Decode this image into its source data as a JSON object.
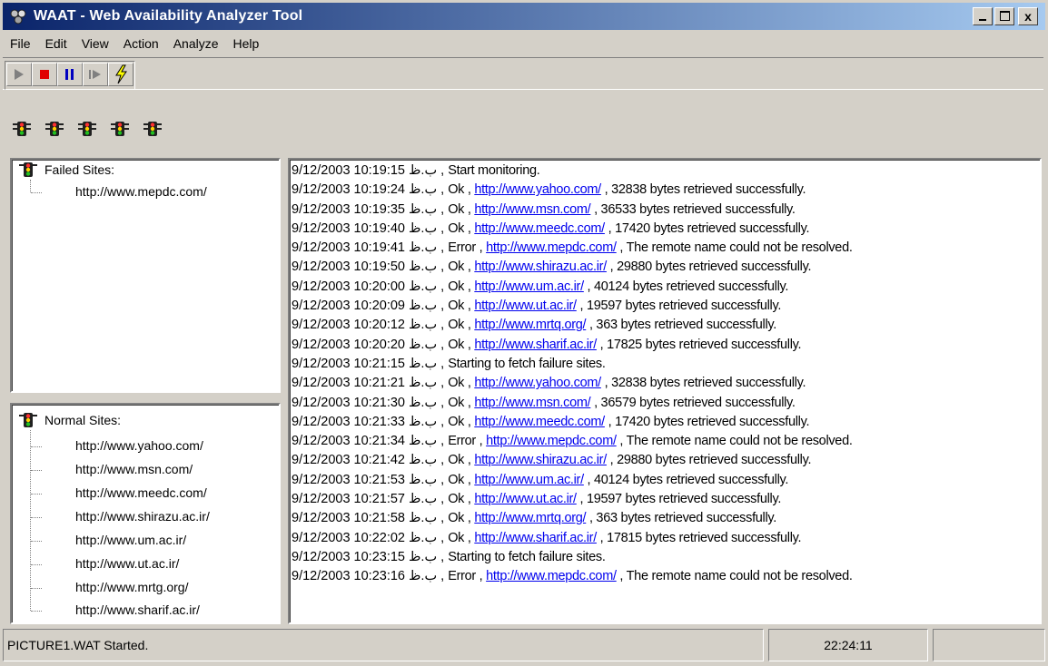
{
  "window": {
    "title": "WAAT - Web Availability Analyzer Tool",
    "title_bar_color": "#0a246a",
    "controls": [
      "minimize-icon",
      "maximize-icon",
      "close-icon"
    ],
    "close_label": "x"
  },
  "menu": [
    "File",
    "Edit",
    "View",
    "Action",
    "Analyze",
    "Help"
  ],
  "toolbar": {
    "buttons": [
      {
        "name": "play",
        "icon": "play-icon",
        "enabled": false
      },
      {
        "name": "stop",
        "icon": "stop-icon",
        "enabled": true,
        "color": "#e00000"
      },
      {
        "name": "pause",
        "icon": "pause-icon",
        "enabled": true,
        "color": "#0000c0"
      },
      {
        "name": "step",
        "icon": "step-icon",
        "enabled": false
      },
      {
        "name": "analyze",
        "icon": "lightning-icon",
        "enabled": true,
        "color": "#ffff00"
      }
    ]
  },
  "status_lights": [
    "traffic-light-icon",
    "traffic-light-icon",
    "traffic-light-icon",
    "traffic-light-icon",
    "traffic-light-icon"
  ],
  "failed_sites": {
    "label": "Failed Sites:",
    "items": [
      "http://www.mepdc.com/"
    ]
  },
  "normal_sites": {
    "label": "Normal Sites:",
    "items": [
      "http://www.yahoo.com/",
      "http://www.msn.com/",
      "http://www.meedc.com/",
      "http://www.shirazu.ac.ir/",
      "http://www.um.ac.ir/",
      "http://www.ut.ac.ir/",
      "http://www.mrtg.org/",
      "http://www.sharif.ac.ir/"
    ]
  },
  "log": [
    {
      "ts": "9/12/2003 10:19:15 ب.ظ",
      "pre": " , Start monitoring.",
      "url": "",
      "post": ""
    },
    {
      "ts": "9/12/2003 10:19:24 ب.ظ",
      "pre": " , Ok , ",
      "url": "http://www.yahoo.com/",
      "post": " , 32838 bytes retrieved successfully."
    },
    {
      "ts": "9/12/2003 10:19:35 ب.ظ",
      "pre": " , Ok , ",
      "url": "http://www.msn.com/",
      "post": " , 36533 bytes retrieved successfully."
    },
    {
      "ts": "9/12/2003 10:19:40 ب.ظ",
      "pre": " , Ok , ",
      "url": "http://www.meedc.com/",
      "post": " , 17420 bytes retrieved successfully."
    },
    {
      "ts": "9/12/2003 10:19:41 ب.ظ",
      "pre": " , Error , ",
      "url": "http://www.mepdc.com/",
      "post": " , The remote name could not be resolved."
    },
    {
      "ts": "9/12/2003 10:19:50 ب.ظ",
      "pre": " , Ok , ",
      "url": "http://www.shirazu.ac.ir/",
      "post": " , 29880 bytes retrieved successfully."
    },
    {
      "ts": "9/12/2003 10:20:00 ب.ظ",
      "pre": " , Ok , ",
      "url": "http://www.um.ac.ir/",
      "post": " , 40124 bytes retrieved successfully."
    },
    {
      "ts": "9/12/2003 10:20:09 ب.ظ",
      "pre": " , Ok , ",
      "url": "http://www.ut.ac.ir/",
      "post": " , 19597 bytes retrieved successfully."
    },
    {
      "ts": "9/12/2003 10:20:12 ب.ظ",
      "pre": " , Ok , ",
      "url": "http://www.mrtq.org/",
      "post": " , 363 bytes retrieved successfully."
    },
    {
      "ts": "9/12/2003 10:20:20 ب.ظ",
      "pre": " , Ok , ",
      "url": "http://www.sharif.ac.ir/",
      "post": " , 17825 bytes retrieved successfully."
    },
    {
      "ts": "9/12/2003 10:21:15 ب.ظ",
      "pre": " , Starting to fetch failure sites.",
      "url": "",
      "post": ""
    },
    {
      "ts": "9/12/2003 10:21:21 ب.ظ",
      "pre": " , Ok , ",
      "url": "http://www.yahoo.com/",
      "post": " , 32838 bytes retrieved successfully."
    },
    {
      "ts": "9/12/2003 10:21:30 ب.ظ",
      "pre": " , Ok , ",
      "url": "http://www.msn.com/",
      "post": " , 36579 bytes retrieved successfully."
    },
    {
      "ts": "9/12/2003 10:21:33 ب.ظ",
      "pre": " , Ok , ",
      "url": "http://www.meedc.com/",
      "post": " , 17420 bytes retrieved successfully."
    },
    {
      "ts": "9/12/2003 10:21:34 ب.ظ",
      "pre": " , Error , ",
      "url": "http://www.mepdc.com/",
      "post": " , The remote name could not be resolved."
    },
    {
      "ts": "9/12/2003 10:21:42 ب.ظ",
      "pre": " , Ok , ",
      "url": "http://www.shirazu.ac.ir/",
      "post": " , 29880 bytes retrieved successfully."
    },
    {
      "ts": "9/12/2003 10:21:53 ب.ظ",
      "pre": " , Ok , ",
      "url": "http://www.um.ac.ir/",
      "post": " , 40124 bytes retrieved successfully."
    },
    {
      "ts": "9/12/2003 10:21:57 ب.ظ",
      "pre": " , Ok , ",
      "url": "http://www.ut.ac.ir/",
      "post": " , 19597 bytes retrieved successfully."
    },
    {
      "ts": "9/12/2003 10:21:58 ب.ظ",
      "pre": " , Ok , ",
      "url": "http://www.mrtq.org/",
      "post": " , 363 bytes retrieved successfully."
    },
    {
      "ts": "9/12/2003 10:22:02 ب.ظ",
      "pre": " , Ok , ",
      "url": "http://www.sharif.ac.ir/",
      "post": " , 17815 bytes retrieved successfully."
    },
    {
      "ts": "9/12/2003 10:23:15 ب.ظ",
      "pre": " , Starting to fetch failure sites.",
      "url": "",
      "post": ""
    },
    {
      "ts": "9/12/2003 10:23:16 ب.ظ",
      "pre": " , Error , ",
      "url": "http://www.mepdc.com/",
      "post": " , The remote name could not be resolved."
    }
  ],
  "link_color": "#0000ee",
  "status": {
    "message": "PICTURE1.WAT Started.",
    "time": "22:24:11"
  }
}
